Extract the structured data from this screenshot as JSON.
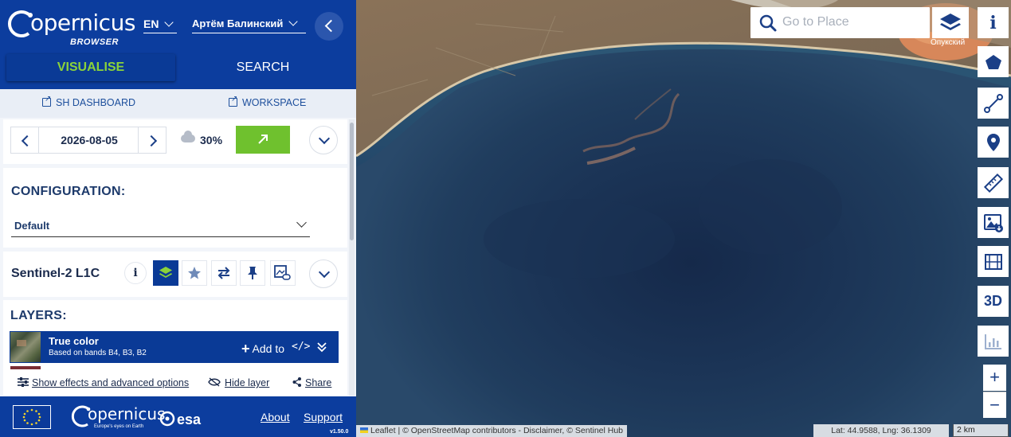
{
  "header": {
    "logo_text": "opernicus",
    "logo_sub": "BROWSER",
    "language": "EN",
    "user": "Артём Балинский",
    "tabs": [
      "VISUALISE",
      "SEARCH"
    ]
  },
  "links": {
    "dashboard": "SH DASHBOARD",
    "workspace": "WORKSPACE"
  },
  "date_panel": {
    "date": "2026-08-05",
    "cloud_coverage": "30%"
  },
  "configuration": {
    "title": "CONFIGURATION:",
    "selected": "Default"
  },
  "satellite": {
    "name": "Sentinel-2 L1C",
    "info_label": "i"
  },
  "layers": {
    "title": "LAYERS:",
    "items": [
      {
        "name": "True color",
        "bands": "Based on bands B4, B3, B2",
        "add_label": "Add to",
        "code_label": "</>"
      }
    ]
  },
  "actions": {
    "effects": "Show effects and advanced options",
    "hide": "Hide layer",
    "share": "Share"
  },
  "footer": {
    "copernicus": "opernicus",
    "copernicus_sub": "Europe's eyes on Earth",
    "esa": "esa",
    "about": "About",
    "support": "Support",
    "version": "v1.50.0"
  },
  "map": {
    "search_placeholder": "Go to Place",
    "place_label": "Опукский",
    "three_d_label": "3D",
    "zoom_in": "+",
    "zoom_out": "−",
    "attribution": "Leaflet | © OpenStreetMap contributors - Disclaimer, © Sentinel Hub",
    "coordinates": "Lat: 44.9588, Lng: 36.1309",
    "scale": "2 km"
  },
  "colors": {
    "brand_blue": "#0c3d9e",
    "accent_green": "#6fc12e",
    "visualise_green": "#8bd33a"
  }
}
